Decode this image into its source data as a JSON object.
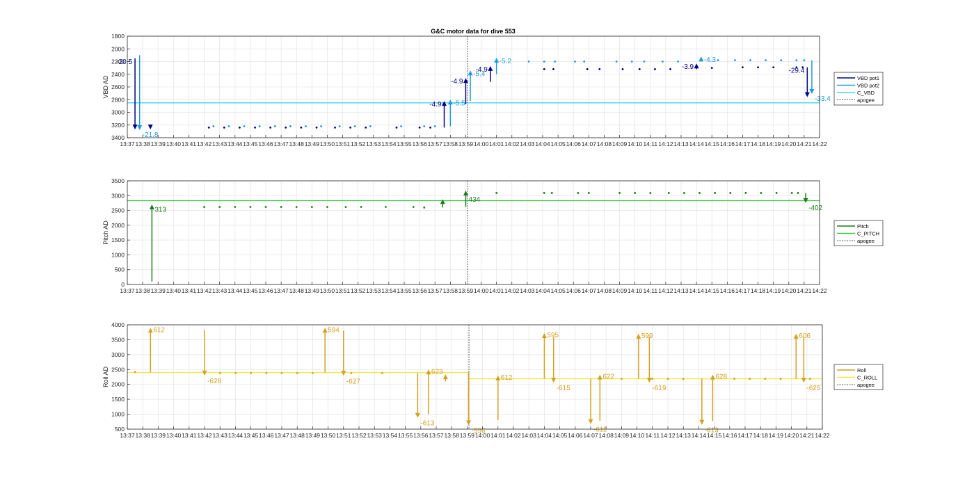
{
  "title": "G&C motor data for dive 553",
  "x_ticks": [
    "13:37",
    "13:38",
    "13:39",
    "13:40",
    "13:41",
    "13:42",
    "13:43",
    "13:44",
    "13:45",
    "13:46",
    "13:47",
    "13:48",
    "13:49",
    "13:50",
    "13:51",
    "13:52",
    "13:53",
    "13:54",
    "13:55",
    "13:56",
    "13:57",
    "13:58",
    "13:59",
    "14:00",
    "14:01",
    "14:02",
    "14:03",
    "14:04",
    "14:05",
    "14:06",
    "14:07",
    "14:08",
    "14:09",
    "14:10",
    "14:11",
    "14:12",
    "14:13",
    "14:14",
    "14:15",
    "14:16",
    "14:17",
    "14:18",
    "14:19",
    "14:20",
    "14:21",
    "14:22"
  ],
  "colors": {
    "vbd_pot1": "#00008B",
    "vbd_pot2": "#1E9BE0",
    "c_vbd": "#40D8E8",
    "pitch": "#1E7B1E",
    "c_pitch": "#3CC93C",
    "roll": "#D4A020",
    "c_roll": "#F2E84A",
    "apogee": "#555555",
    "grid": "#E6E6E6"
  },
  "chart_data": [
    {
      "type": "scatter",
      "ylabel": "VBD AD",
      "ylim": [
        1800,
        3400
      ],
      "y_reversed": true,
      "y_ticks": [
        1800,
        2000,
        2200,
        2400,
        2600,
        2800,
        3000,
        3200,
        3400
      ],
      "legend": [
        "VBD pot1",
        "VBD pot2",
        "C_VBD",
        "apogee"
      ],
      "legend_position": "right",
      "grid": true,
      "apogee_minute": 22.12,
      "reference_line": {
        "name": "C_VBD",
        "value": 2850
      },
      "series": [
        {
          "name": "VBD pot1",
          "x": [
            5.3,
            6.3,
            7.3,
            8.3,
            9.3,
            10.3,
            11.3,
            12.3,
            13.5,
            14.5,
            15.5,
            17.5,
            19.0,
            19.7,
            27.1,
            27.7,
            29.9,
            30.7,
            32.2,
            33.3,
            34.3,
            35.3,
            38.0,
            40.0,
            41.0,
            42.0,
            43.5,
            43.9
          ],
          "values": [
            3240,
            3240,
            3240,
            3240,
            3240,
            3240,
            3240,
            3240,
            3240,
            3240,
            3240,
            3240,
            3240,
            3240,
            2320,
            2320,
            2320,
            2320,
            2320,
            2320,
            2320,
            2320,
            2300,
            2290,
            2290,
            2290,
            2290,
            2290
          ]
        },
        {
          "name": "VBD pot2",
          "x": [
            5.6,
            6.6,
            7.6,
            8.6,
            9.6,
            10.6,
            11.6,
            12.6,
            13.8,
            14.8,
            15.8,
            17.8,
            19.3,
            20.0,
            26.1,
            27.1,
            27.8,
            29.1,
            29.7,
            31.8,
            32.8,
            33.6,
            34.8,
            35.8,
            38.4,
            39.5,
            40.5,
            41.5,
            42.5,
            43.5,
            44.0
          ],
          "values": [
            3220,
            3220,
            3220,
            3220,
            3220,
            3220,
            3220,
            3220,
            3220,
            3220,
            3220,
            3220,
            3220,
            3220,
            2200,
            2200,
            2200,
            2200,
            2200,
            2200,
            2200,
            2200,
            2200,
            2200,
            2180,
            2180,
            2180,
            2180,
            2180,
            2180,
            2180
          ]
        },
        {
          "name": "VBD pot1 move",
          "arrows": [
            {
              "x": 0.5,
              "from": 2150,
              "to": 3270,
              "label": "-20.5"
            },
            {
              "x": 1.5,
              "from": 3230,
              "to": 3270,
              "label": ""
            },
            {
              "x": 20.6,
              "from": 3240,
              "to": 2820,
              "label": "-4.9"
            },
            {
              "x": 22.0,
              "from": 2870,
              "to": 2460,
              "label": "-4.9"
            },
            {
              "x": 23.6,
              "from": 2520,
              "to": 2270,
              "label": "-4.9"
            },
            {
              "x": 37.0,
              "from": 2320,
              "to": 2230,
              "label": "-3.9"
            },
            {
              "x": 44.2,
              "from": 2290,
              "to": 2760,
              "label": "-29.4"
            }
          ]
        },
        {
          "name": "VBD pot2 move",
          "arrows": [
            {
              "x": 0.8,
              "from": 2100,
              "to": 3280,
              "label": "-21.8"
            },
            {
              "x": 21.0,
              "from": 3220,
              "to": 2800,
              "label": "-5.5"
            },
            {
              "x": 22.3,
              "from": 2820,
              "to": 2340,
              "label": "-5.4"
            },
            {
              "x": 24.0,
              "from": 2400,
              "to": 2140,
              "label": "-5.2"
            },
            {
              "x": 37.3,
              "from": 2200,
              "to": 2120,
              "label": "-4.3"
            },
            {
              "x": 44.5,
              "from": 2180,
              "to": 2710,
              "label": "-33.4"
            }
          ]
        }
      ]
    },
    {
      "type": "scatter",
      "ylabel": "Pitch AD",
      "ylim": [
        0,
        3500
      ],
      "y_ticks": [
        0,
        500,
        1000,
        1500,
        2000,
        2500,
        3000,
        3500
      ],
      "legend": [
        "Pitch",
        "C_PITCH",
        "apogee"
      ],
      "legend_position": "right",
      "grid": true,
      "apogee_minute": 22.12,
      "reference_line": {
        "name": "C_PITCH",
        "value": 2830
      },
      "series": [
        {
          "name": "Pitch",
          "x": [
            5.0,
            6.0,
            7.0,
            8.0,
            9.0,
            10.0,
            11.0,
            12.0,
            13.0,
            14.2,
            15.2,
            16.8,
            18.6,
            19.3,
            24.0,
            27.1,
            27.6,
            29.3,
            30.0,
            32.0,
            33.0,
            34.0,
            35.2,
            36.2,
            37.2,
            38.2,
            39.2,
            40.2,
            41.2,
            42.2,
            43.2,
            43.6
          ],
          "values": [
            2620,
            2620,
            2620,
            2620,
            2620,
            2620,
            2620,
            2620,
            2620,
            2620,
            2620,
            2620,
            2620,
            2600,
            3090,
            3090,
            3090,
            3090,
            3090,
            3090,
            3090,
            3090,
            3090,
            3090,
            3090,
            3090,
            3090,
            3090,
            3090,
            3090,
            3090,
            3090
          ]
        },
        {
          "name": "Pitch move",
          "arrows": [
            {
              "x": 1.6,
              "from": 100,
              "to": 2700,
              "label": "313"
            },
            {
              "x": 20.5,
              "from": 2600,
              "to": 2880,
              "label": ""
            },
            {
              "x": 22.0,
              "from": 2620,
              "to": 3170,
              "label": "434"
            },
            {
              "x": 44.1,
              "from": 3090,
              "to": 2750,
              "label": "-402"
            }
          ]
        }
      ]
    },
    {
      "type": "scatter",
      "ylabel": "Roll AD",
      "ylim": [
        500,
        4000
      ],
      "y_ticks": [
        500,
        1000,
        1500,
        2000,
        2500,
        3000,
        3500,
        4000
      ],
      "legend": [
        "Roll",
        "C_ROLL",
        "apogee"
      ],
      "legend_position": "right",
      "grid": true,
      "apogee_minute": 22.12,
      "reference_lines": [
        {
          "name": "C_ROLL",
          "value": 2400,
          "from_minute": 0,
          "to_minute": 22.12
        },
        {
          "name": "C_ROLL",
          "value": 2190,
          "from_minute": 22.12,
          "to_minute": 45
        }
      ],
      "series": [
        {
          "name": "Roll",
          "x": [
            0.5,
            6.0,
            7.0,
            8.0,
            9.0,
            10.0,
            11.0,
            12.0,
            14.5,
            16.5,
            32.0,
            34.0,
            35.0,
            36.0,
            39.3,
            40.3,
            41.3,
            42.3,
            43.8,
            44.2
          ],
          "values": [
            2420,
            2380,
            2380,
            2380,
            2380,
            2380,
            2380,
            2380,
            2380,
            2380,
            2190,
            2190,
            2190,
            2190,
            2190,
            2190,
            2190,
            2190,
            2190,
            2190
          ]
        },
        {
          "name": "Roll move",
          "arrows": [
            {
              "x": 1.5,
              "from": 2400,
              "to": 3900,
              "label": "612"
            },
            {
              "x": 5.0,
              "from": 3820,
              "to": 2300,
              "label": "-628"
            },
            {
              "x": 12.8,
              "from": 2400,
              "to": 3900,
              "label": "594"
            },
            {
              "x": 14.0,
              "from": 3800,
              "to": 2290,
              "label": "-627"
            },
            {
              "x": 18.8,
              "from": 2380,
              "to": 880,
              "label": "-613"
            },
            {
              "x": 19.5,
              "from": 1010,
              "to": 2500,
              "label": "623"
            },
            {
              "x": 20.6,
              "from": 2100,
              "to": 2340,
              "label": ""
            },
            {
              "x": 22.1,
              "from": 2400,
              "to": 630,
              "label": "-596"
            },
            {
              "x": 24.0,
              "from": 800,
              "to": 2300,
              "label": "612"
            },
            {
              "x": 27.0,
              "from": 2190,
              "to": 3720,
              "label": "595"
            },
            {
              "x": 27.6,
              "from": 3600,
              "to": 2060,
              "label": "-615"
            },
            {
              "x": 30.0,
              "from": 2190,
              "to": 670,
              "label": "-611"
            },
            {
              "x": 30.6,
              "from": 780,
              "to": 2330,
              "label": "622"
            },
            {
              "x": 33.1,
              "from": 2190,
              "to": 3700,
              "label": "599"
            },
            {
              "x": 33.8,
              "from": 3600,
              "to": 2060,
              "label": "-619"
            },
            {
              "x": 37.2,
              "from": 2190,
              "to": 650,
              "label": "-613"
            },
            {
              "x": 37.9,
              "from": 770,
              "to": 2330,
              "label": "628"
            },
            {
              "x": 43.3,
              "from": 2190,
              "to": 3700,
              "label": "606"
            },
            {
              "x": 43.8,
              "from": 3600,
              "to": 2060,
              "label": "-625"
            }
          ]
        }
      ]
    }
  ]
}
